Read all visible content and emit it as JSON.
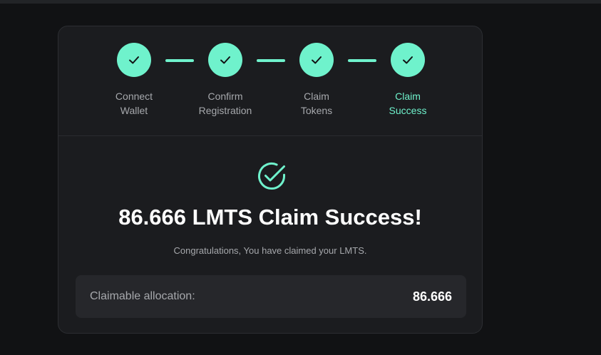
{
  "stepper": {
    "steps": [
      {
        "line1": "Connect",
        "line2": "Wallet",
        "status": "complete",
        "icon": "check-icon"
      },
      {
        "line1": "Confirm",
        "line2": "Registration",
        "status": "complete",
        "icon": "check-icon"
      },
      {
        "line1": "Claim",
        "line2": "Tokens",
        "status": "complete",
        "icon": "check-icon"
      },
      {
        "line1": "Claim",
        "line2": "Success",
        "status": "active",
        "icon": "check-icon"
      }
    ]
  },
  "result": {
    "icon": "check-circle-icon",
    "title": "86.666 LMTS Claim Success!",
    "subtitle": "Congratulations, You have claimed your LMTS."
  },
  "allocation": {
    "label": "Claimable allocation:",
    "value": "86.666"
  },
  "colors": {
    "accent": "#6ff2cc",
    "page_background": "#111214",
    "card_background": "#1b1c1f",
    "panel_background": "#26272b",
    "text_primary": "#ffffff",
    "text_secondary": "#a6a8ac"
  }
}
